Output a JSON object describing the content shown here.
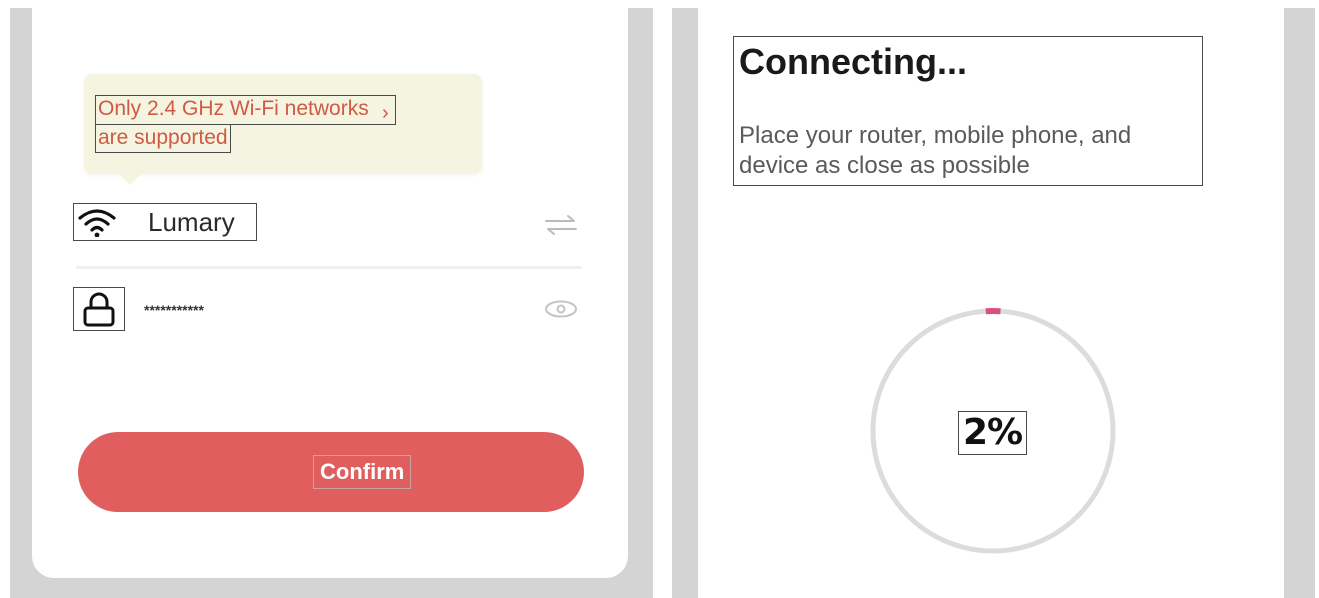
{
  "wifi_form": {
    "tip_line1": "Only 2.4 GHz Wi-Fi networks",
    "tip_line2": "are supported",
    "tip_chevron": "›",
    "network_name": "Lumary",
    "password_masked": "***********",
    "confirm_label": "Confirm",
    "icons": [
      "wifi-icon",
      "switch-network-icon",
      "lock-icon",
      "eye-icon"
    ]
  },
  "connecting": {
    "title": "Connecting...",
    "subtitle": "Place your router, mobile phone, and device as close as possible",
    "progress_text": "2%",
    "progress_value": 2
  },
  "colors": {
    "accent": "#e05e5e",
    "tip_text": "#d05a45",
    "tip_background": "#f4f4e0",
    "ring_track": "#dcdcdc",
    "ring_progress": "#d9507a"
  }
}
